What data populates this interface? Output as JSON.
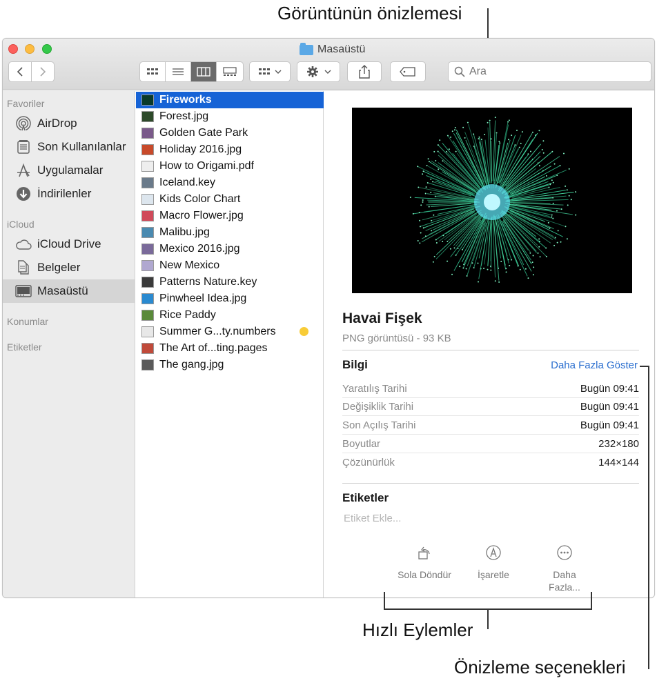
{
  "callouts": {
    "preview": "Görüntünün önizlemesi",
    "quick_actions": "Hızlı Eylemler",
    "preview_options": "Önizleme seçenekleri"
  },
  "window": {
    "title": "Masaüstü",
    "search_placeholder": "Ara"
  },
  "sidebar": {
    "favorites_header": "Favoriler",
    "favorites": [
      {
        "label": "AirDrop",
        "icon": "airdrop-icon"
      },
      {
        "label": "Son Kullanılanlar",
        "icon": "recents-icon"
      },
      {
        "label": "Uygulamalar",
        "icon": "applications-icon"
      },
      {
        "label": "İndirilenler",
        "icon": "downloads-icon"
      }
    ],
    "icloud_header": "iCloud",
    "icloud": [
      {
        "label": "iCloud Drive",
        "icon": "cloud-icon"
      },
      {
        "label": "Belgeler",
        "icon": "documents-icon"
      },
      {
        "label": "Masaüstü",
        "icon": "desktop-icon"
      }
    ],
    "locations_header": "Konumlar",
    "tags_header": "Etiketler"
  },
  "files": [
    {
      "name": "Fireworks",
      "color": "#0a3a2a"
    },
    {
      "name": "Forest.jpg",
      "color": "#2d4a2a"
    },
    {
      "name": "Golden Gate Park",
      "color": "#7a5a8a"
    },
    {
      "name": "Holiday 2016.jpg",
      "color": "#c84a2a"
    },
    {
      "name": "How to Origami.pdf",
      "color": "#eeeeee"
    },
    {
      "name": "Iceland.key",
      "color": "#6a7a8a"
    },
    {
      "name": "Kids Color Chart",
      "color": "#dde6ee"
    },
    {
      "name": "Macro Flower.jpg",
      "color": "#d04a5a"
    },
    {
      "name": "Malibu.jpg",
      "color": "#4a8ab0"
    },
    {
      "name": "Mexico 2016.jpg",
      "color": "#7a6a9a"
    },
    {
      "name": "New Mexico",
      "color": "#b0a8d0"
    },
    {
      "name": "Patterns Nature.key",
      "color": "#3a3a3a"
    },
    {
      "name": "Pinwheel Idea.jpg",
      "color": "#2a8ad0"
    },
    {
      "name": "Rice Paddy",
      "color": "#5a8a3a"
    },
    {
      "name": "Summer G...ty.numbers",
      "color": "#e8e8e8"
    },
    {
      "name": "The Art of...ting.pages",
      "color": "#c04a3a"
    },
    {
      "name": "The gang.jpg",
      "color": "#5a5a5a"
    }
  ],
  "preview": {
    "name": "Havai Fişek",
    "kind": "PNG görüntüsü - 93 KB",
    "info_title": "Bilgi",
    "show_more": "Daha Fazla Göster",
    "info": [
      {
        "key": "Yaratılış Tarihi",
        "value": "Bugün 09:41"
      },
      {
        "key": "Değişiklik Tarihi",
        "value": "Bugün 09:41"
      },
      {
        "key": "Son Açılış Tarihi",
        "value": "Bugün 09:41"
      },
      {
        "key": "Boyutlar",
        "value": "232×180"
      },
      {
        "key": "Çözünürlük",
        "value": "144×144"
      }
    ],
    "tags_title": "Etiketler",
    "tags_placeholder": "Etiket Ekle...",
    "actions": {
      "rotate_line1": "Sola Döndür",
      "markup_line1": "İşaretle",
      "more_line1": "Daha",
      "more_line2": "Fazla..."
    }
  },
  "colors": {
    "selection": "#1663d6",
    "link": "#2a6ecf",
    "tag_dot": "#f8cc37",
    "firework": "#3be0a0"
  }
}
